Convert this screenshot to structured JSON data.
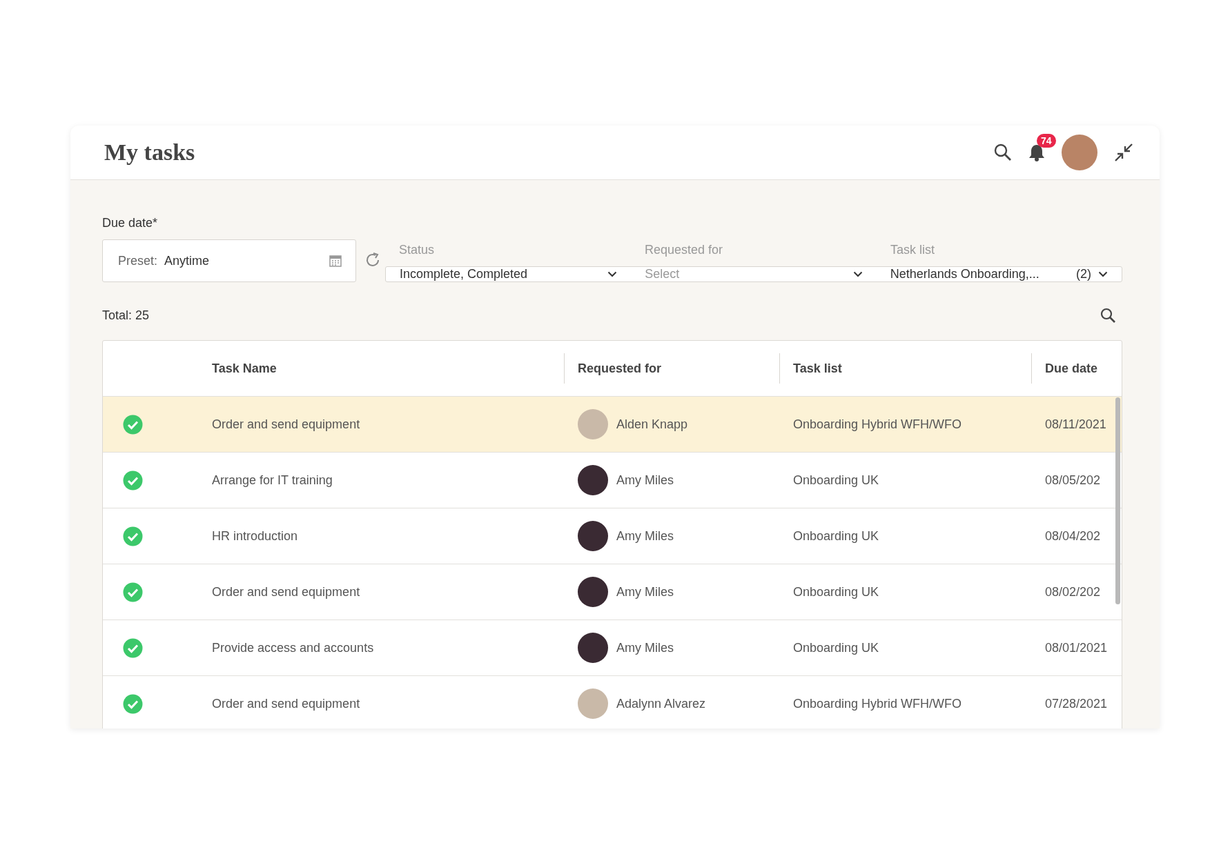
{
  "header": {
    "title": "My tasks",
    "notification_count": "74"
  },
  "filters": [
    {
      "kind": "date",
      "label": "Due date*",
      "prefix": "Preset:",
      "value": "Anytime"
    },
    {
      "kind": "select",
      "label": "Status",
      "value": "Incomplete, Completed"
    },
    {
      "kind": "select",
      "label": "Requested for",
      "placeholder": "Select"
    },
    {
      "kind": "select",
      "label": "Task list",
      "value": "Netherlands Onboarding,...",
      "count": "(2)"
    }
  ],
  "total": "Total: 25",
  "table": {
    "columns": [
      "Task Name",
      "Requested for",
      "Task list",
      "Due date"
    ],
    "rows": [
      {
        "completed": true,
        "selected": true,
        "task": "Order and send equipment",
        "requested_for": "Alden Knapp",
        "task_list": "Onboarding Hybrid WFH/WFO",
        "due_date": "08/11/2021"
      },
      {
        "completed": true,
        "selected": false,
        "task": "Arrange for IT training",
        "requested_for": "Amy Miles",
        "task_list": "Onboarding UK",
        "due_date": "08/05/202"
      },
      {
        "completed": true,
        "selected": false,
        "task": "HR introduction",
        "requested_for": "Amy Miles",
        "task_list": "Onboarding UK",
        "due_date": "08/04/202"
      },
      {
        "completed": true,
        "selected": false,
        "task": "Order and send equipment",
        "requested_for": "Amy Miles",
        "task_list": "Onboarding UK",
        "due_date": "08/02/202"
      },
      {
        "completed": true,
        "selected": false,
        "task": "Provide access and accounts",
        "requested_for": "Amy Miles",
        "task_list": "Onboarding UK",
        "due_date": "08/01/2021"
      },
      {
        "completed": true,
        "selected": false,
        "task": "Order and send equipment",
        "requested_for": "Adalynn Alvarez",
        "task_list": "Onboarding Hybrid WFH/WFO",
        "due_date": "07/28/2021"
      }
    ]
  }
}
